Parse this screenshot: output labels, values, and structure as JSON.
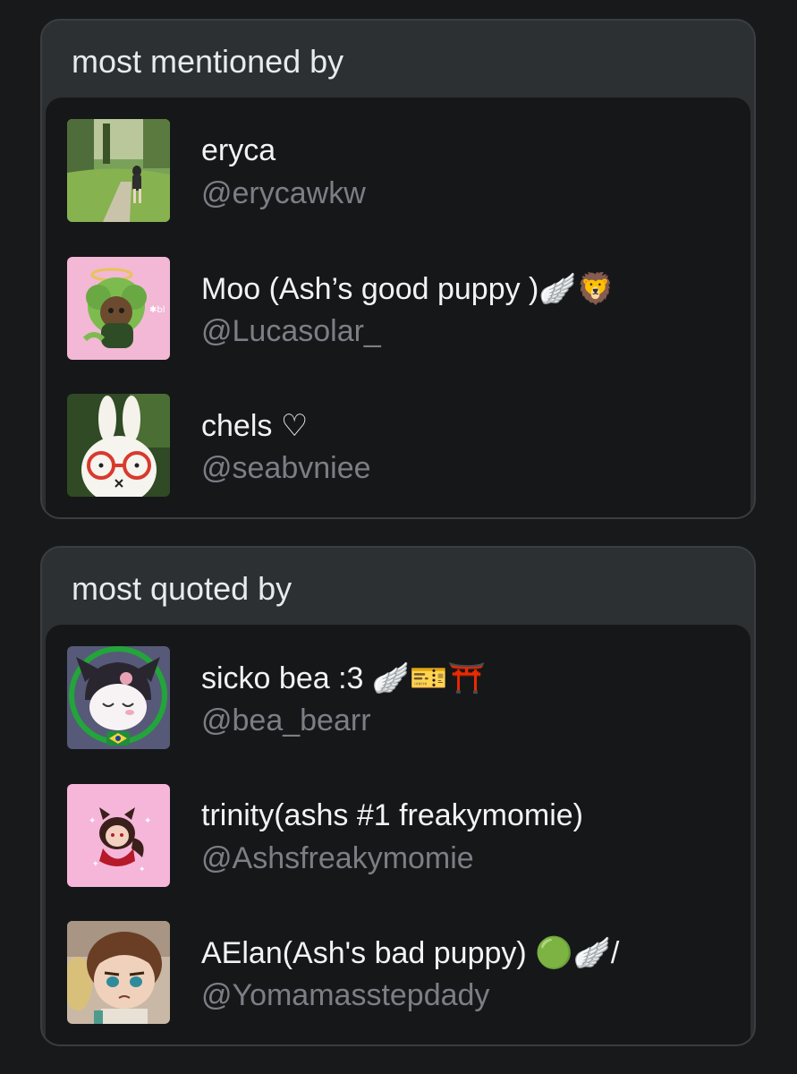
{
  "sections": [
    {
      "title": "most mentioned by",
      "users": [
        {
          "name": "eryca",
          "handle": "@erycawkw"
        },
        {
          "name": "Moo (Ash’s good puppy )🪽🦁",
          "handle": "@Lucasolar_"
        },
        {
          "name": "chels ♡",
          "handle": "@seabvniee"
        }
      ]
    },
    {
      "title": "most quoted by",
      "users": [
        {
          "name": "sicko bea :3 🪽🎫⛩️",
          "handle": "@bea_bearr"
        },
        {
          "name": "trinity(ashs #1 freakymomie)",
          "handle": "@Ashsfreakymomie"
        },
        {
          "name": "AElan(Ash's bad puppy) 🟢🪽/",
          "handle": "@Yomamasstepdady"
        }
      ]
    }
  ],
  "colors": {
    "background": "#18191b",
    "card": "#2d3033",
    "card_body": "#161719",
    "name_text": "#f1f3f4",
    "handle_text": "#7b7f85"
  }
}
